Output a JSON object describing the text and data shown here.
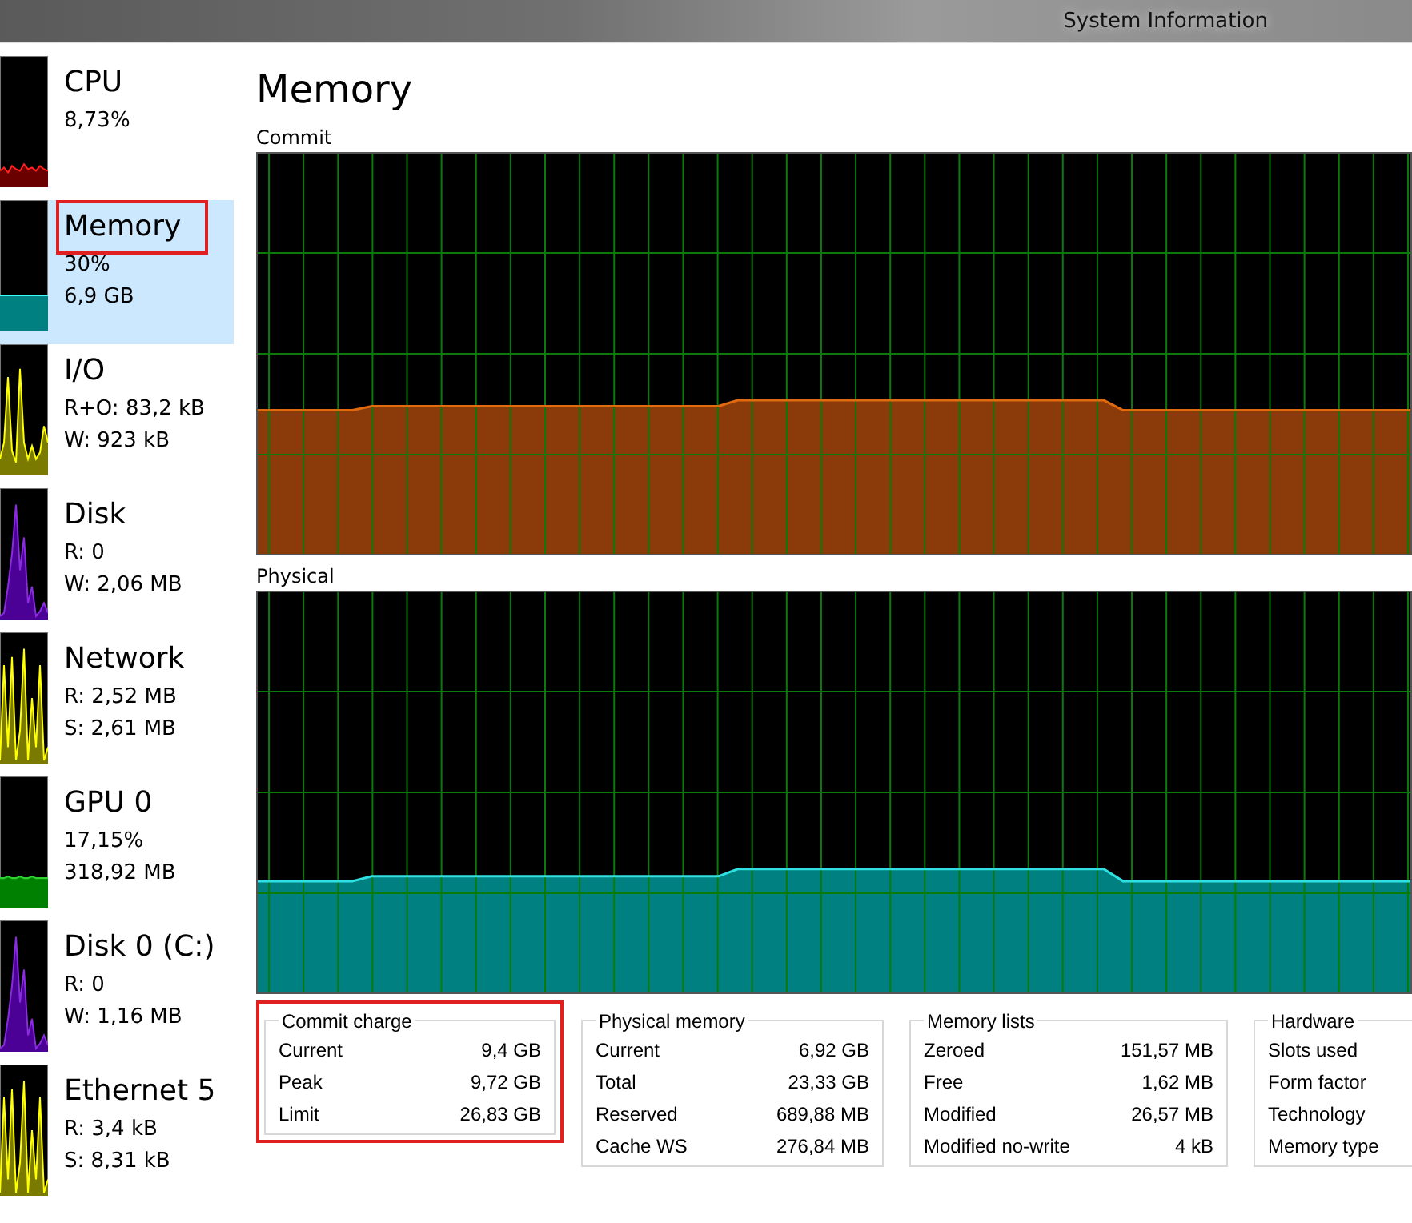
{
  "window": {
    "title": "System Information"
  },
  "sidebar": {
    "items": [
      {
        "kind": "cpu",
        "name": "CPU",
        "lines": [
          "8,73%"
        ],
        "selected": false,
        "highlighted": false
      },
      {
        "kind": "memory",
        "name": "Memory",
        "lines": [
          "30%",
          "6,9 GB"
        ],
        "selected": true,
        "highlighted": true
      },
      {
        "kind": "io",
        "name": "I/O",
        "lines": [
          "R+O: 83,2 kB",
          "W: 923 kB"
        ],
        "selected": false,
        "highlighted": false
      },
      {
        "kind": "disk",
        "name": "Disk",
        "lines": [
          "R: 0",
          "W: 2,06 MB"
        ],
        "selected": false,
        "highlighted": false
      },
      {
        "kind": "network",
        "name": "Network",
        "lines": [
          "R: 2,52 MB",
          "S: 2,61 MB"
        ],
        "selected": false,
        "highlighted": false
      },
      {
        "kind": "gpu",
        "name": "GPU 0",
        "lines": [
          "17,15%",
          "318,92 MB"
        ],
        "selected": false,
        "highlighted": false
      },
      {
        "kind": "disk",
        "name": "Disk 0 (C:)",
        "lines": [
          "R: 0",
          "W: 1,16 MB"
        ],
        "selected": false,
        "highlighted": false
      },
      {
        "kind": "network",
        "name": "Ethernet 5",
        "lines": [
          "R: 3,4 kB",
          "S: 8,31 kB"
        ],
        "selected": false,
        "highlighted": false
      }
    ]
  },
  "main": {
    "title": "Memory",
    "graphs": [
      {
        "kind": "commit",
        "label": "Commit"
      },
      {
        "kind": "physical",
        "label": "Physical"
      }
    ],
    "panels": [
      {
        "title": "Commit charge",
        "highlighted": true,
        "rows": [
          {
            "label": "Current",
            "value": "9,4 GB"
          },
          {
            "label": "Peak",
            "value": "9,72 GB"
          },
          {
            "label": "Limit",
            "value": "26,83 GB"
          }
        ]
      },
      {
        "title": "Physical memory",
        "highlighted": false,
        "rows": [
          {
            "label": "Current",
            "value": "6,92 GB"
          },
          {
            "label": "Total",
            "value": "23,33 GB"
          },
          {
            "label": "Reserved",
            "value": "689,88 MB"
          },
          {
            "label": "Cache WS",
            "value": "276,84 MB"
          }
        ]
      },
      {
        "title": "Memory lists",
        "highlighted": false,
        "rows": [
          {
            "label": "Zeroed",
            "value": "151,57 MB"
          },
          {
            "label": "Free",
            "value": "1,62 MB"
          },
          {
            "label": "Modified",
            "value": "26,57 MB"
          },
          {
            "label": "Modified no-write",
            "value": "4 kB"
          }
        ]
      },
      {
        "title": "Hardware",
        "highlighted": false,
        "rows": [
          {
            "label": "Slots used"
          },
          {
            "label": "Form factor"
          },
          {
            "label": "Technology"
          },
          {
            "label": "Memory type"
          }
        ]
      }
    ]
  }
}
